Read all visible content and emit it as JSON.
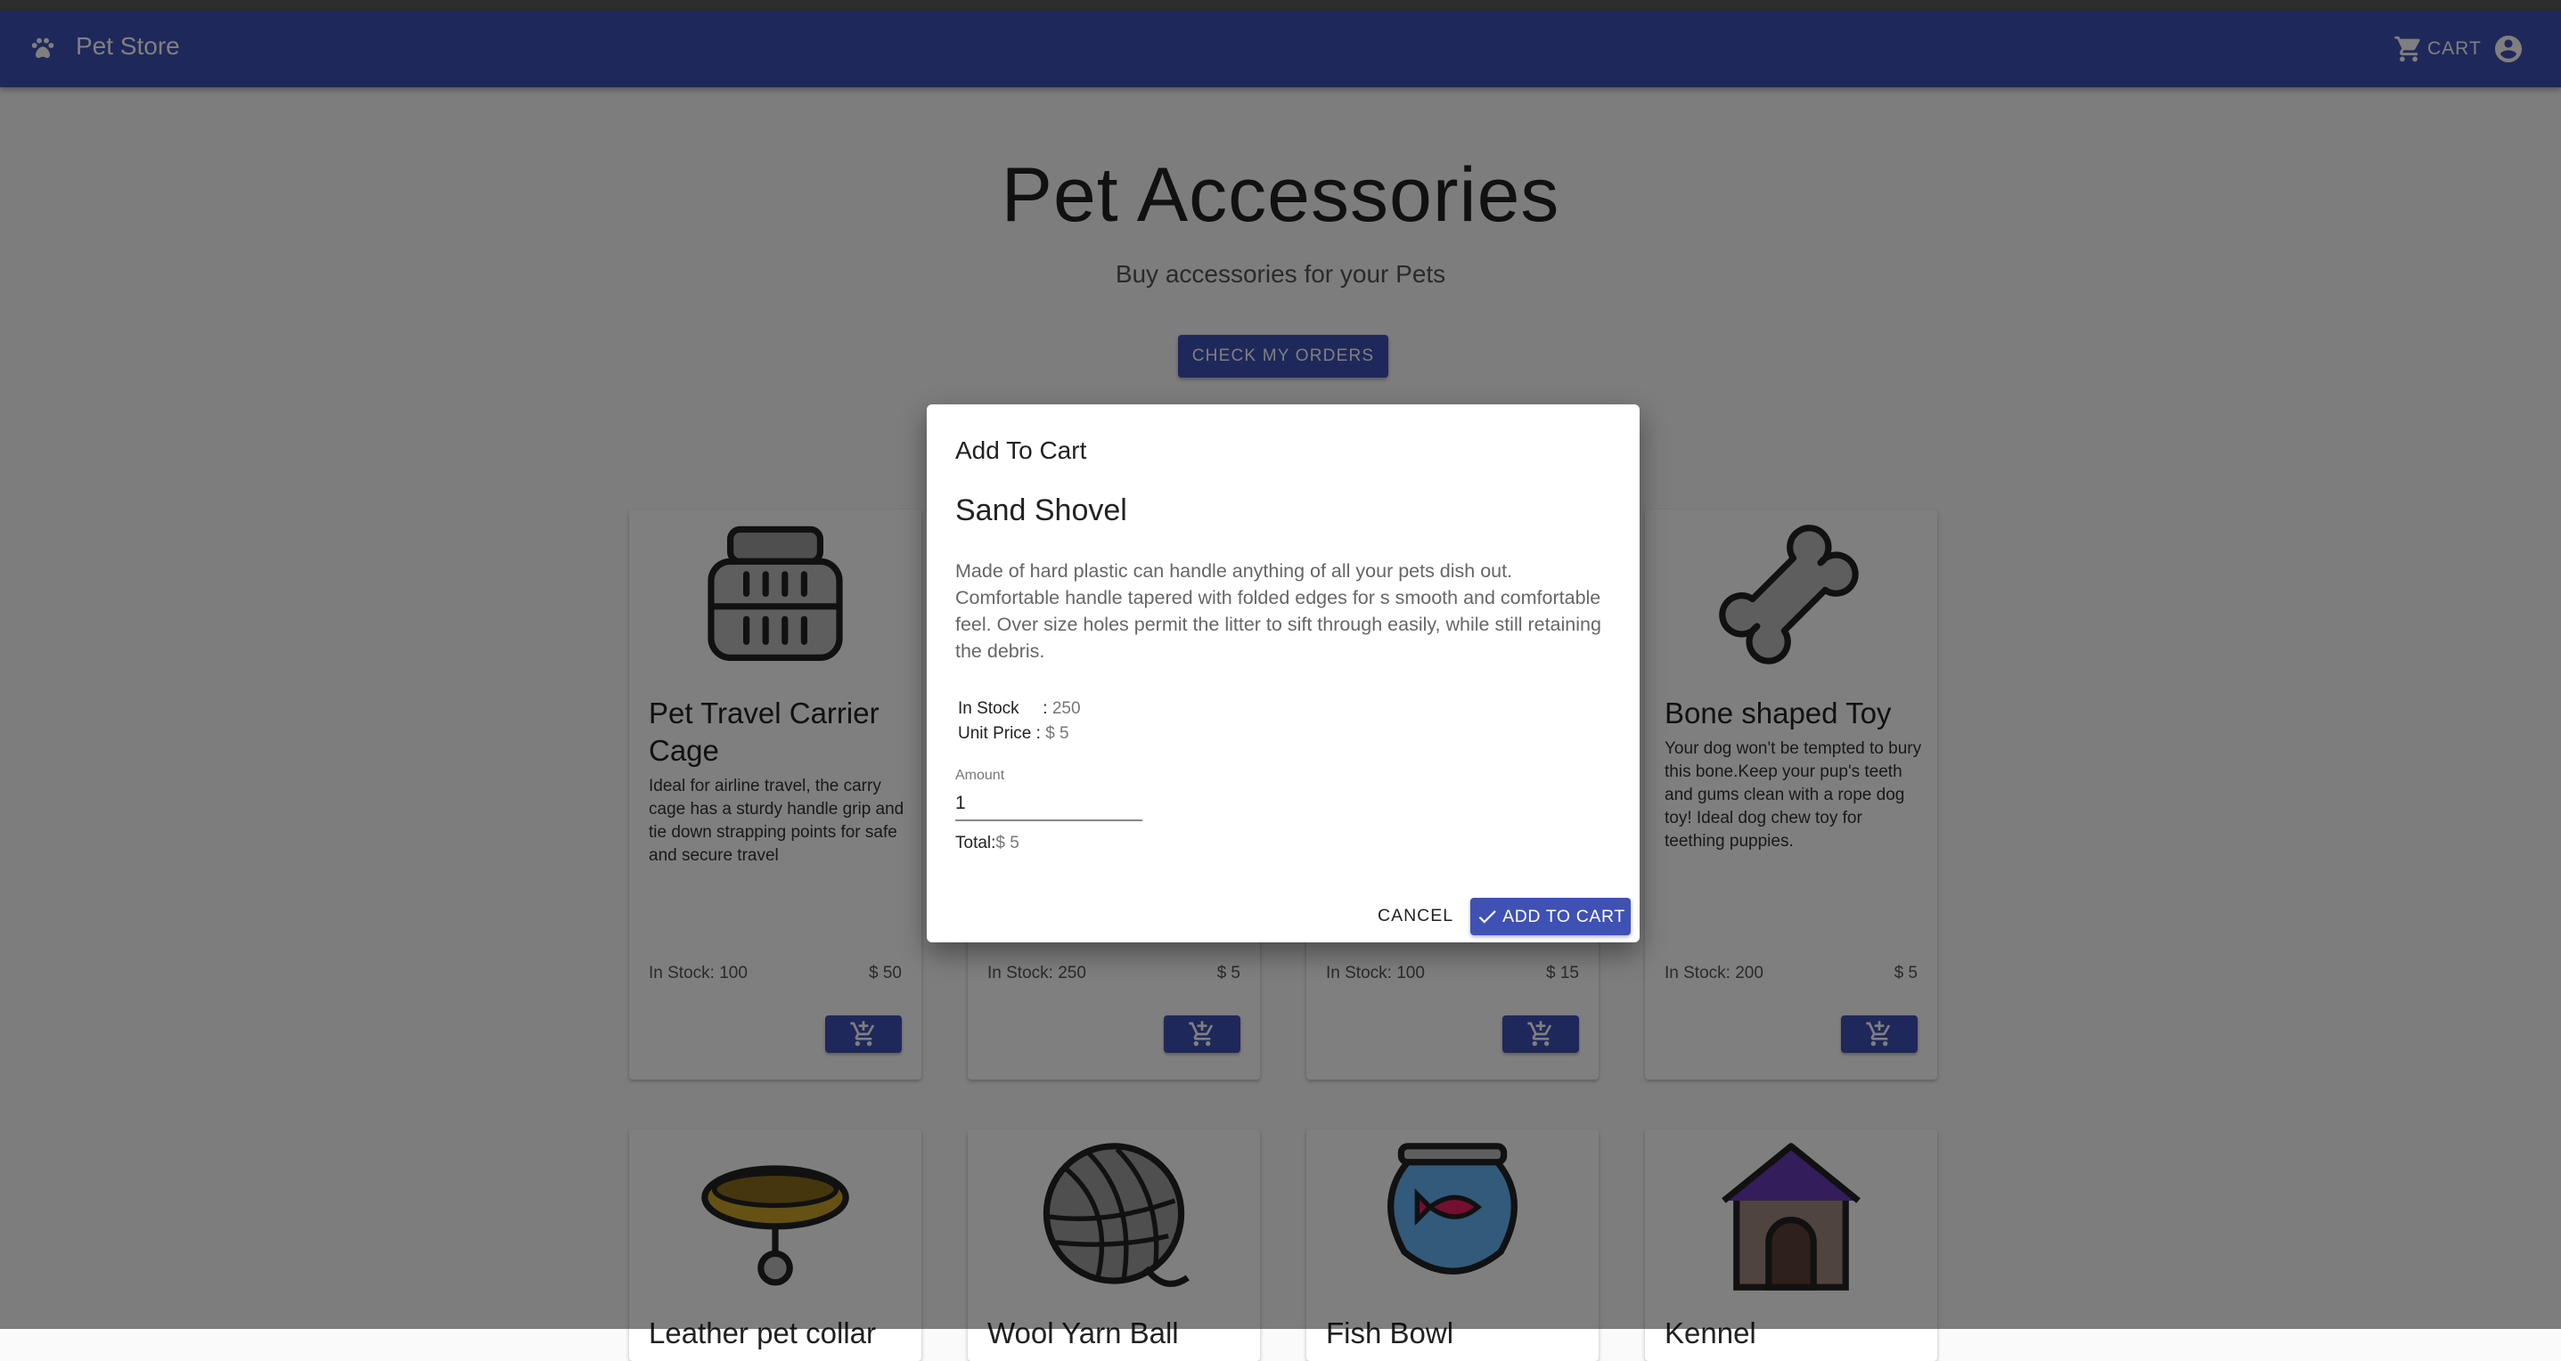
{
  "app": {
    "brand": "Pet Store",
    "cart_label": "CART",
    "icons": [
      "paw-icon",
      "cart-icon",
      "account-icon"
    ]
  },
  "hero": {
    "title": "Pet Accessories",
    "subtitle": "Buy accessories for your Pets",
    "orders_button": "CHECK MY ORDERS"
  },
  "products": [
    {
      "title": "Pet Travel Carrier Cage",
      "desc": "Ideal for airline travel, the carry cage has a sturdy handle grip and tie down strapping points for safe and secure travel",
      "stock": "In Stock: 100",
      "price": "$ 50",
      "icon": "carrier-icon"
    },
    {
      "title": "",
      "desc": "",
      "stock": "In Stock: 250",
      "price": "$ 5",
      "icon": ""
    },
    {
      "title": "",
      "desc": "",
      "stock": "In Stock: 100",
      "price": "$ 15",
      "icon": ""
    },
    {
      "title": "Bone shaped Toy",
      "desc": "Your dog won't be tempted to bury this bone.Keep your pup's teeth and gums clean with a rope dog toy! Ideal dog chew toy for teething puppies.",
      "stock": "In Stock: 200",
      "price": "$ 5",
      "icon": "bone-icon"
    },
    {
      "title": "Leather pet collar",
      "icon": "collar-icon"
    },
    {
      "title": "Wool Yarn Ball",
      "icon": "yarn-ball-icon"
    },
    {
      "title": "Fish Bowl",
      "icon": "fish-bowl-icon"
    },
    {
      "title": "Kennel",
      "icon": "kennel-icon"
    }
  ],
  "dialog": {
    "title": "Add To Cart",
    "product_name": "Sand Shovel",
    "description": "Made of hard plastic can handle anything of all your pets dish out. Comfortable handle tapered with folded edges for s smooth and comfortable feel. Over size holes permit the litter to sift through easily, while still retaining the debris.",
    "in_stock_label": "In Stock",
    "in_stock_sep": ":",
    "in_stock_value": "250",
    "unit_price_label": "Unit Price :",
    "unit_price_value": "$ 5",
    "amount_label": "Amount",
    "amount_value": "1",
    "total_label": "Total:",
    "total_value": "$ 5",
    "cancel_label": "CANCEL",
    "add_label": "ADD TO CART"
  },
  "colors": {
    "primary": "#3f51b5",
    "overlay": "rgba(0,0,0,0.5)"
  }
}
